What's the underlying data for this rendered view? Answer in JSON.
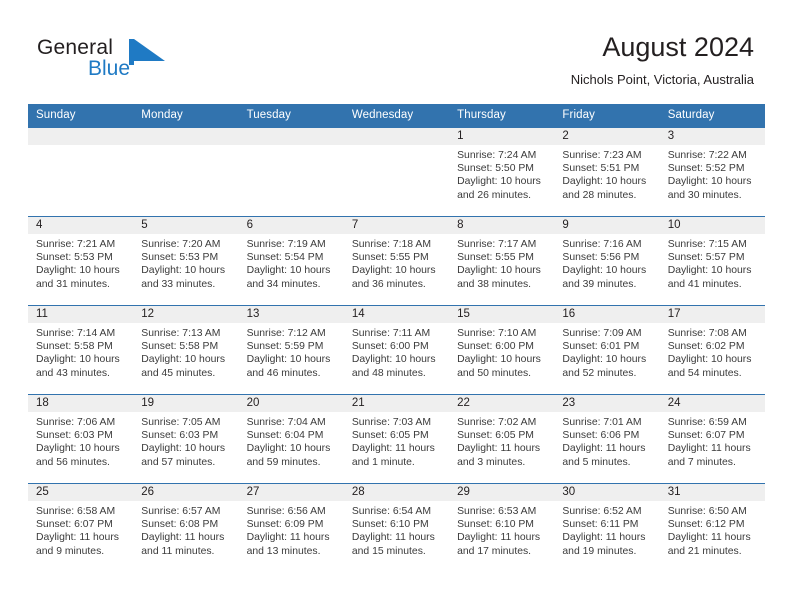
{
  "brand": {
    "name_top": "General",
    "name_bottom": "Blue",
    "mark": "triangle-logo",
    "accent_color": "#1f7ac4"
  },
  "header": {
    "title": "August 2024",
    "location": "Nichols Point, Victoria, Australia"
  },
  "theme": {
    "header_blue": "#3273ae",
    "date_band_gray": "#efefef",
    "text": "#231f20"
  },
  "weekday_headers": [
    "Sunday",
    "Monday",
    "Tuesday",
    "Wednesday",
    "Thursday",
    "Friday",
    "Saturday"
  ],
  "weeks": [
    [
      {
        "day": "",
        "sunrise": "",
        "sunset": "",
        "daylight1": "",
        "daylight2": ""
      },
      {
        "day": "",
        "sunrise": "",
        "sunset": "",
        "daylight1": "",
        "daylight2": ""
      },
      {
        "day": "",
        "sunrise": "",
        "sunset": "",
        "daylight1": "",
        "daylight2": ""
      },
      {
        "day": "",
        "sunrise": "",
        "sunset": "",
        "daylight1": "",
        "daylight2": ""
      },
      {
        "day": "1",
        "sunrise": "Sunrise: 7:24 AM",
        "sunset": "Sunset: 5:50 PM",
        "daylight1": "Daylight: 10 hours",
        "daylight2": "and 26 minutes."
      },
      {
        "day": "2",
        "sunrise": "Sunrise: 7:23 AM",
        "sunset": "Sunset: 5:51 PM",
        "daylight1": "Daylight: 10 hours",
        "daylight2": "and 28 minutes."
      },
      {
        "day": "3",
        "sunrise": "Sunrise: 7:22 AM",
        "sunset": "Sunset: 5:52 PM",
        "daylight1": "Daylight: 10 hours",
        "daylight2": "and 30 minutes."
      }
    ],
    [
      {
        "day": "4",
        "sunrise": "Sunrise: 7:21 AM",
        "sunset": "Sunset: 5:53 PM",
        "daylight1": "Daylight: 10 hours",
        "daylight2": "and 31 minutes."
      },
      {
        "day": "5",
        "sunrise": "Sunrise: 7:20 AM",
        "sunset": "Sunset: 5:53 PM",
        "daylight1": "Daylight: 10 hours",
        "daylight2": "and 33 minutes."
      },
      {
        "day": "6",
        "sunrise": "Sunrise: 7:19 AM",
        "sunset": "Sunset: 5:54 PM",
        "daylight1": "Daylight: 10 hours",
        "daylight2": "and 34 minutes."
      },
      {
        "day": "7",
        "sunrise": "Sunrise: 7:18 AM",
        "sunset": "Sunset: 5:55 PM",
        "daylight1": "Daylight: 10 hours",
        "daylight2": "and 36 minutes."
      },
      {
        "day": "8",
        "sunrise": "Sunrise: 7:17 AM",
        "sunset": "Sunset: 5:55 PM",
        "daylight1": "Daylight: 10 hours",
        "daylight2": "and 38 minutes."
      },
      {
        "day": "9",
        "sunrise": "Sunrise: 7:16 AM",
        "sunset": "Sunset: 5:56 PM",
        "daylight1": "Daylight: 10 hours",
        "daylight2": "and 39 minutes."
      },
      {
        "day": "10",
        "sunrise": "Sunrise: 7:15 AM",
        "sunset": "Sunset: 5:57 PM",
        "daylight1": "Daylight: 10 hours",
        "daylight2": "and 41 minutes."
      }
    ],
    [
      {
        "day": "11",
        "sunrise": "Sunrise: 7:14 AM",
        "sunset": "Sunset: 5:58 PM",
        "daylight1": "Daylight: 10 hours",
        "daylight2": "and 43 minutes."
      },
      {
        "day": "12",
        "sunrise": "Sunrise: 7:13 AM",
        "sunset": "Sunset: 5:58 PM",
        "daylight1": "Daylight: 10 hours",
        "daylight2": "and 45 minutes."
      },
      {
        "day": "13",
        "sunrise": "Sunrise: 7:12 AM",
        "sunset": "Sunset: 5:59 PM",
        "daylight1": "Daylight: 10 hours",
        "daylight2": "and 46 minutes."
      },
      {
        "day": "14",
        "sunrise": "Sunrise: 7:11 AM",
        "sunset": "Sunset: 6:00 PM",
        "daylight1": "Daylight: 10 hours",
        "daylight2": "and 48 minutes."
      },
      {
        "day": "15",
        "sunrise": "Sunrise: 7:10 AM",
        "sunset": "Sunset: 6:00 PM",
        "daylight1": "Daylight: 10 hours",
        "daylight2": "and 50 minutes."
      },
      {
        "day": "16",
        "sunrise": "Sunrise: 7:09 AM",
        "sunset": "Sunset: 6:01 PM",
        "daylight1": "Daylight: 10 hours",
        "daylight2": "and 52 minutes."
      },
      {
        "day": "17",
        "sunrise": "Sunrise: 7:08 AM",
        "sunset": "Sunset: 6:02 PM",
        "daylight1": "Daylight: 10 hours",
        "daylight2": "and 54 minutes."
      }
    ],
    [
      {
        "day": "18",
        "sunrise": "Sunrise: 7:06 AM",
        "sunset": "Sunset: 6:03 PM",
        "daylight1": "Daylight: 10 hours",
        "daylight2": "and 56 minutes."
      },
      {
        "day": "19",
        "sunrise": "Sunrise: 7:05 AM",
        "sunset": "Sunset: 6:03 PM",
        "daylight1": "Daylight: 10 hours",
        "daylight2": "and 57 minutes."
      },
      {
        "day": "20",
        "sunrise": "Sunrise: 7:04 AM",
        "sunset": "Sunset: 6:04 PM",
        "daylight1": "Daylight: 10 hours",
        "daylight2": "and 59 minutes."
      },
      {
        "day": "21",
        "sunrise": "Sunrise: 7:03 AM",
        "sunset": "Sunset: 6:05 PM",
        "daylight1": "Daylight: 11 hours",
        "daylight2": "and 1 minute."
      },
      {
        "day": "22",
        "sunrise": "Sunrise: 7:02 AM",
        "sunset": "Sunset: 6:05 PM",
        "daylight1": "Daylight: 11 hours",
        "daylight2": "and 3 minutes."
      },
      {
        "day": "23",
        "sunrise": "Sunrise: 7:01 AM",
        "sunset": "Sunset: 6:06 PM",
        "daylight1": "Daylight: 11 hours",
        "daylight2": "and 5 minutes."
      },
      {
        "day": "24",
        "sunrise": "Sunrise: 6:59 AM",
        "sunset": "Sunset: 6:07 PM",
        "daylight1": "Daylight: 11 hours",
        "daylight2": "and 7 minutes."
      }
    ],
    [
      {
        "day": "25",
        "sunrise": "Sunrise: 6:58 AM",
        "sunset": "Sunset: 6:07 PM",
        "daylight1": "Daylight: 11 hours",
        "daylight2": "and 9 minutes."
      },
      {
        "day": "26",
        "sunrise": "Sunrise: 6:57 AM",
        "sunset": "Sunset: 6:08 PM",
        "daylight1": "Daylight: 11 hours",
        "daylight2": "and 11 minutes."
      },
      {
        "day": "27",
        "sunrise": "Sunrise: 6:56 AM",
        "sunset": "Sunset: 6:09 PM",
        "daylight1": "Daylight: 11 hours",
        "daylight2": "and 13 minutes."
      },
      {
        "day": "28",
        "sunrise": "Sunrise: 6:54 AM",
        "sunset": "Sunset: 6:10 PM",
        "daylight1": "Daylight: 11 hours",
        "daylight2": "and 15 minutes."
      },
      {
        "day": "29",
        "sunrise": "Sunrise: 6:53 AM",
        "sunset": "Sunset: 6:10 PM",
        "daylight1": "Daylight: 11 hours",
        "daylight2": "and 17 minutes."
      },
      {
        "day": "30",
        "sunrise": "Sunrise: 6:52 AM",
        "sunset": "Sunset: 6:11 PM",
        "daylight1": "Daylight: 11 hours",
        "daylight2": "and 19 minutes."
      },
      {
        "day": "31",
        "sunrise": "Sunrise: 6:50 AM",
        "sunset": "Sunset: 6:12 PM",
        "daylight1": "Daylight: 11 hours",
        "daylight2": "and 21 minutes."
      }
    ]
  ]
}
